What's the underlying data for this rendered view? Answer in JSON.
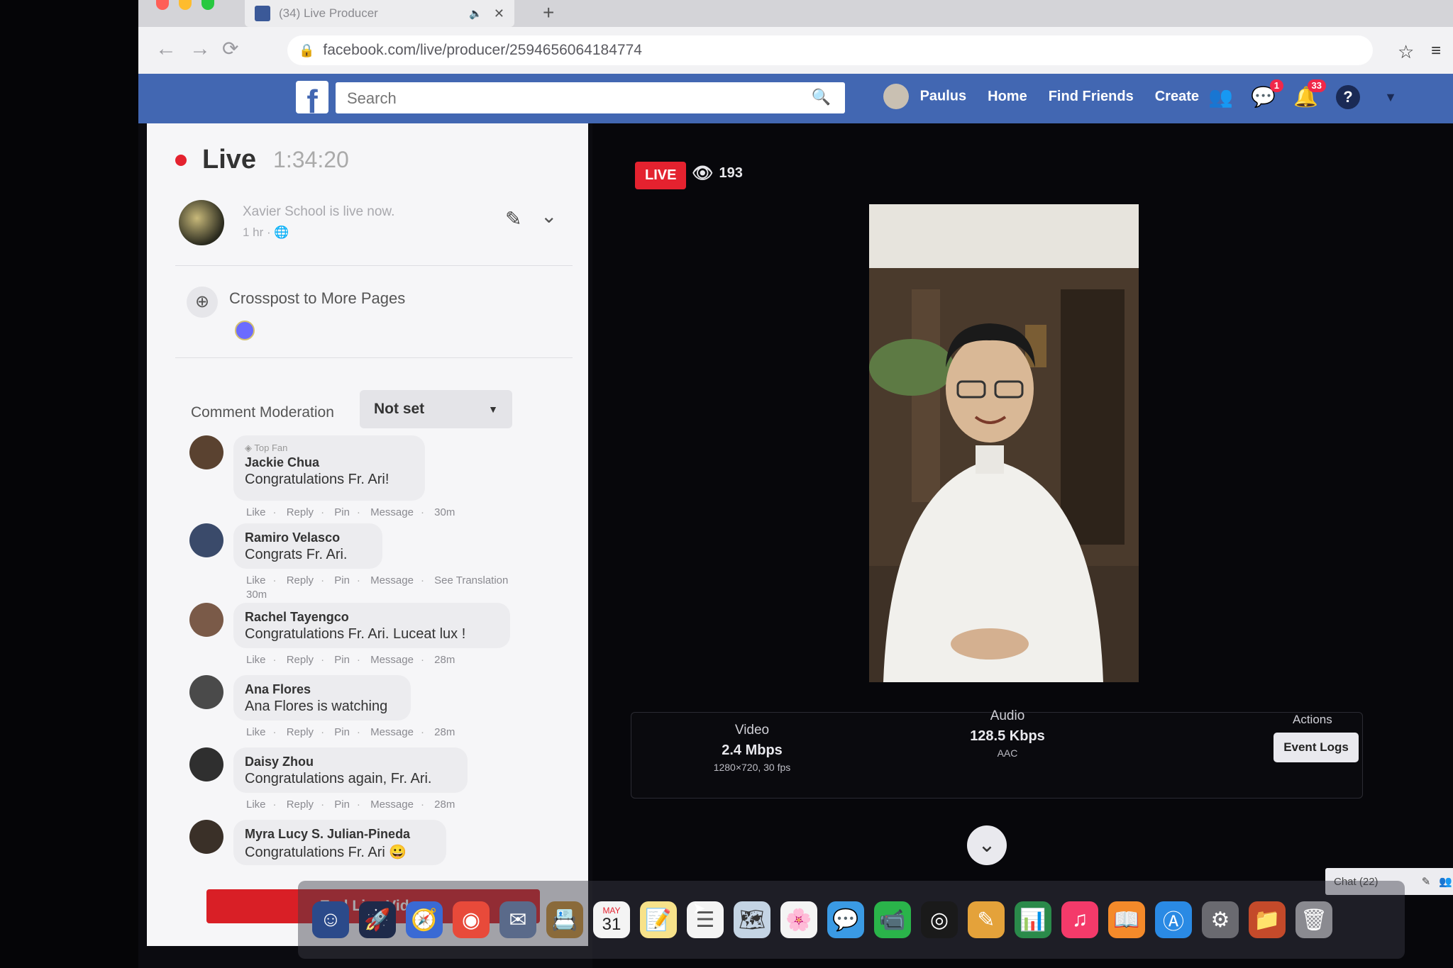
{
  "browser": {
    "tab_title": "(34) Live Producer",
    "url": "facebook.com/live/producer/2594656064184774"
  },
  "fb": {
    "search_placeholder": "Search",
    "user_name": "Paulus",
    "nav": [
      "Home",
      "Find Friends",
      "Create"
    ],
    "badges": {
      "messages": "1",
      "notifications": "33"
    }
  },
  "left": {
    "live_label": "Live",
    "timer": "1:34:20",
    "page_status": "Xavier School is live now.",
    "page_time": "1 hr · ",
    "crosspost_label": "Crosspost to More Pages",
    "moderation_label": "Comment Moderation",
    "moderation_value": "Not set",
    "end_button": "End Live Video"
  },
  "comments": [
    {
      "top_fan": "Top Fan",
      "name": "Jackie Chua",
      "text": "Congratulations Fr. Ari!",
      "actions": [
        "Like",
        "Reply",
        "Pin",
        "Message"
      ],
      "time": "30m"
    },
    {
      "top_fan": "",
      "name": "Ramiro Velasco",
      "text": "Congrats Fr. Ari.",
      "actions": [
        "Like",
        "Reply",
        "Pin",
        "Message",
        "See Translation"
      ],
      "time": "30m"
    },
    {
      "top_fan": "",
      "name": "Rachel Tayengco",
      "text": "Congratulations Fr. Ari. Luceat lux !",
      "actions": [
        "Like",
        "Reply",
        "Pin",
        "Message"
      ],
      "time": "28m"
    },
    {
      "top_fan": "",
      "name": "Ana Flores",
      "text": "Ana Flores is watching",
      "actions": [
        "Like",
        "Reply",
        "Pin",
        "Message"
      ],
      "time": "28m"
    },
    {
      "top_fan": "",
      "name": "Daisy Zhou",
      "text": "Congratulations again, Fr. Ari.",
      "actions": [
        "Like",
        "Reply",
        "Pin",
        "Message"
      ],
      "time": "28m"
    },
    {
      "top_fan": "",
      "name": "Myra Lucy S. Julian-Pineda",
      "text": "Congratulations Fr. Ari 😀",
      "actions": [],
      "time": ""
    }
  ],
  "stage": {
    "live_badge": "LIVE",
    "viewers": "193",
    "video": {
      "label": "Video",
      "value": "2.4 Mbps",
      "sub": "1280×720, 30 fps"
    },
    "audio": {
      "label": "Audio",
      "value": "128.5 Kbps",
      "sub": "AAC"
    },
    "actions_label": "Actions",
    "event_logs": "Event Logs",
    "chat": "Chat (22)"
  },
  "dock": {
    "calendar_day": "31",
    "calendar_month": "MAY"
  },
  "colors": {
    "fb_blue": "#4267b2",
    "live_red": "#e4222f",
    "end_red": "#d91f26"
  }
}
